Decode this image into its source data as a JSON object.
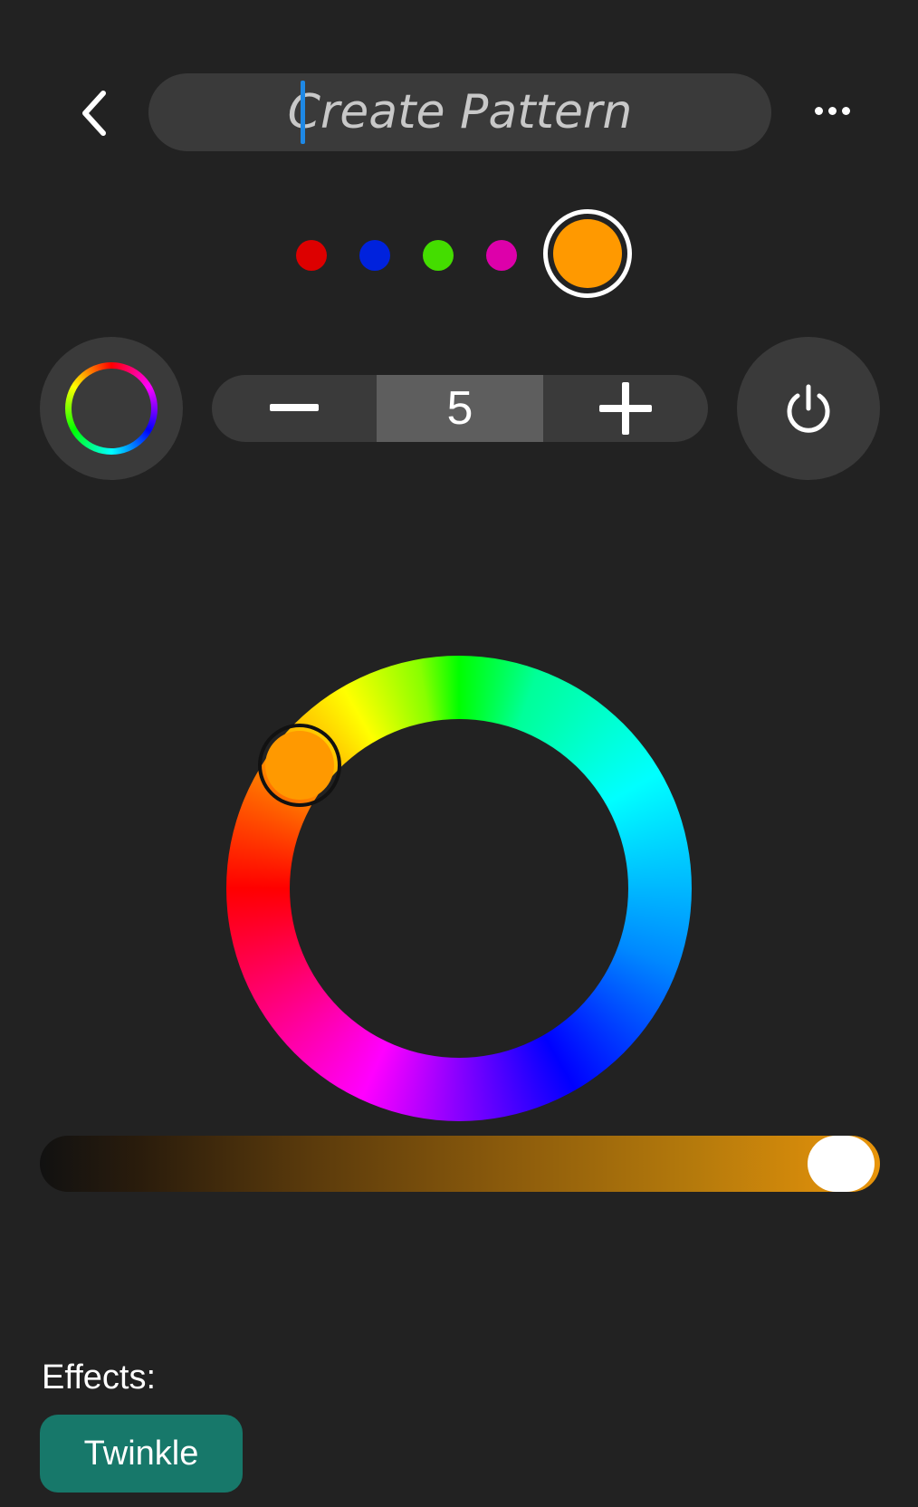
{
  "header": {
    "title_placeholder": "Create Pattern",
    "back_icon": "chevron-left-icon",
    "more_icon": "more-horizontal-icon"
  },
  "palette": {
    "colors": [
      "#dd0000",
      "#0022dd",
      "#44dd00",
      "#dd00aa"
    ],
    "selected_color": "#ff9900"
  },
  "controls": {
    "rainbow_icon": "color-wheel-icon",
    "count_value": "5",
    "decrement_icon": "minus-icon",
    "increment_icon": "plus-icon",
    "power_icon": "power-icon"
  },
  "color_wheel": {
    "selected_color": "#ff9900"
  },
  "brightness": {
    "level": 1.0,
    "accent": "#e8940a"
  },
  "effects": {
    "label": "Effects:",
    "items": [
      "Twinkle"
    ],
    "chip_color": "#17786a"
  }
}
